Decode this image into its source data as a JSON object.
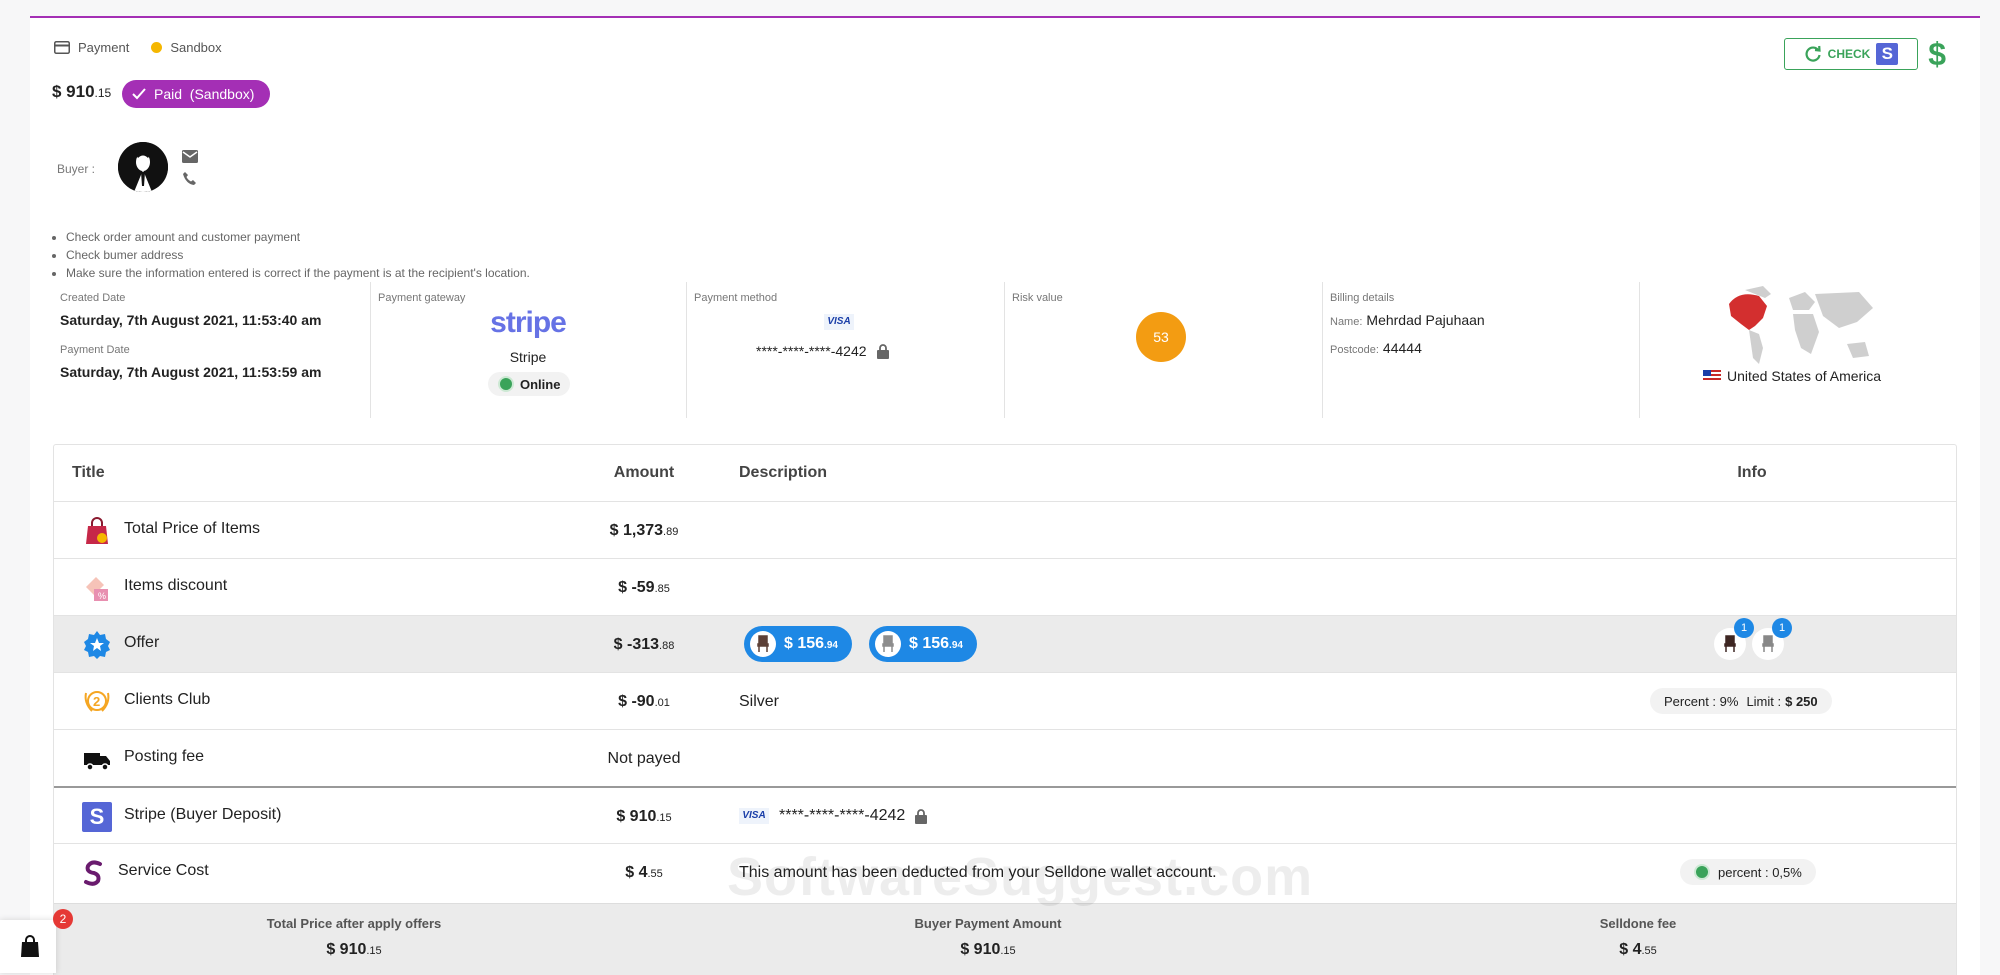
{
  "header": {
    "breadcrumb_payment": "Payment",
    "breadcrumb_mode": "Sandbox",
    "amount_main": "$ 910",
    "amount_cents": ".15",
    "status_badge": "Paid  (Sandbox)",
    "check_label": "CHECK"
  },
  "buyer": {
    "label": "Buyer :"
  },
  "checklist": [
    "Check order amount and customer payment",
    "Check bumer address",
    "Make sure the information entered is correct if the payment is at the recipient's location."
  ],
  "info": {
    "created_label": "Created Date",
    "created_value": "Saturday, 7th August 2021, 11:53:40 am",
    "payment_date_label": "Payment Date",
    "payment_date_value": "Saturday, 7th August 2021, 11:53:59 am",
    "gateway_label": "Payment gateway",
    "gateway_logo": "stripe",
    "gateway_name": "Stripe",
    "gateway_status": "Online",
    "method_label": "Payment method",
    "method_brand": "VISA",
    "method_card": "****-****-****-4242",
    "risk_label": "Risk value",
    "risk_value": "53",
    "billing_label": "Billing details",
    "billing_name_label": "Name:",
    "billing_name": "Mehrdad Pajuhaan",
    "billing_postcode_label": "Postcode:",
    "billing_postcode": "44444",
    "country": "United States of America"
  },
  "table": {
    "headers": {
      "title": "Title",
      "amount": "Amount",
      "description": "Description",
      "info": "Info"
    },
    "rows": [
      {
        "title": "Total Price of Items",
        "amount": "$ 1,373",
        "cents": ".89",
        "icon": "shopping-bag-icon"
      },
      {
        "title": "Items discount",
        "amount": "$ -59",
        "cents": ".85",
        "icon": "discount-icon"
      },
      {
        "title": "Offer",
        "amount": "$ -313",
        "cents": ".88",
        "icon": "offer-badge-icon",
        "offers": [
          {
            "value": "$ 156",
            "cents": ".94"
          },
          {
            "value": "$ 156",
            "cents": ".94"
          }
        ],
        "offer_counts": [
          "1",
          "1"
        ]
      },
      {
        "title": "Clients Club",
        "amount": "$ -90",
        "cents": ".01",
        "icon": "club-medal-icon",
        "description": "Silver",
        "info_percent": "Percent : 9%",
        "info_limit_label": "Limit :",
        "info_limit": "$ 250"
      },
      {
        "title": "Posting fee",
        "amount_text": "Not payed",
        "icon": "truck-icon"
      },
      {
        "title": "Stripe (Buyer Deposit)",
        "amount": "$ 910",
        "cents": ".15",
        "icon": "stripe-icon",
        "brand": "VISA",
        "card": "****-****-****-4242"
      },
      {
        "title": "Service Cost",
        "amount": "$ 4",
        "cents": ".55",
        "icon": "selldone-icon",
        "description": "This amount has been deducted from your Selldone wallet account.",
        "info": "percent : 0,5%"
      }
    ]
  },
  "footer": {
    "total_label": "Total Price after apply offers",
    "total_value": "$ 910",
    "total_cents": ".15",
    "buyer_label": "Buyer Payment Amount",
    "buyer_value": "$ 910",
    "buyer_cents": ".15",
    "fee_label": "Selldone fee",
    "fee_value": "$ 4",
    "fee_cents": ".55"
  },
  "watermark": "SoftwareSuggest.com",
  "cart_count": "2",
  "colors": {
    "accent": "#a42fb5",
    "success": "#3aa35a",
    "info": "#1e88e5",
    "risk": "#f39c12"
  }
}
